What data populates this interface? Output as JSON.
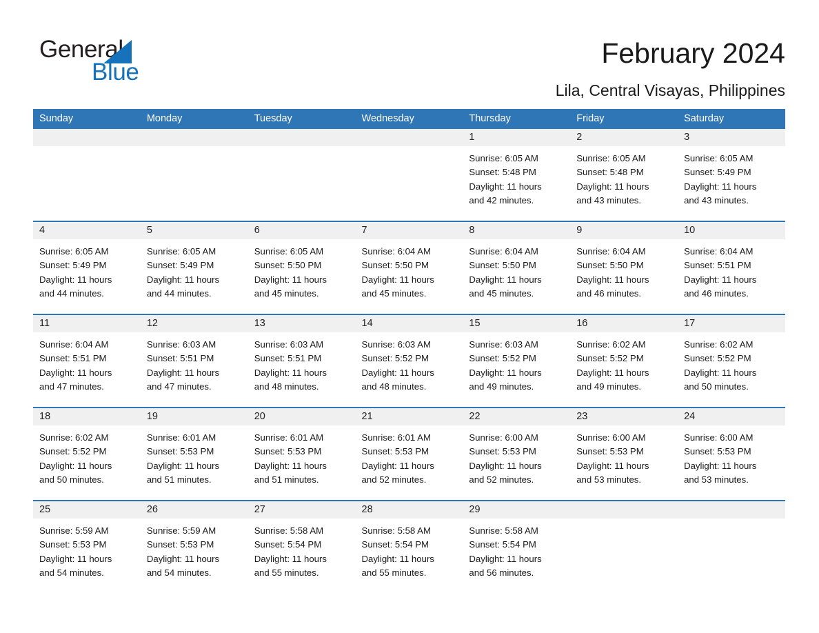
{
  "brand": {
    "name_part1": "General",
    "name_part2": "Blue",
    "logo_blue": "#1673bb"
  },
  "header": {
    "title": "February 2024",
    "subtitle": "Lila, Central Visayas, Philippines"
  },
  "theme": {
    "header_blue": "#2f76b7",
    "daynum_band": "#f0f0f0",
    "text": "#1a1a1a"
  },
  "weekdays": [
    "Sunday",
    "Monday",
    "Tuesday",
    "Wednesday",
    "Thursday",
    "Friday",
    "Saturday"
  ],
  "weeks": [
    [
      {
        "day": "",
        "empty": true
      },
      {
        "day": "",
        "empty": true
      },
      {
        "day": "",
        "empty": true
      },
      {
        "day": "",
        "empty": true
      },
      {
        "day": "1",
        "sunrise": "Sunrise: 6:05 AM",
        "sunset": "Sunset: 5:48 PM",
        "daylight_line1": "Daylight: 11 hours",
        "daylight_line2": "and 42 minutes."
      },
      {
        "day": "2",
        "sunrise": "Sunrise: 6:05 AM",
        "sunset": "Sunset: 5:48 PM",
        "daylight_line1": "Daylight: 11 hours",
        "daylight_line2": "and 43 minutes."
      },
      {
        "day": "3",
        "sunrise": "Sunrise: 6:05 AM",
        "sunset": "Sunset: 5:49 PM",
        "daylight_line1": "Daylight: 11 hours",
        "daylight_line2": "and 43 minutes."
      }
    ],
    [
      {
        "day": "4",
        "sunrise": "Sunrise: 6:05 AM",
        "sunset": "Sunset: 5:49 PM",
        "daylight_line1": "Daylight: 11 hours",
        "daylight_line2": "and 44 minutes."
      },
      {
        "day": "5",
        "sunrise": "Sunrise: 6:05 AM",
        "sunset": "Sunset: 5:49 PM",
        "daylight_line1": "Daylight: 11 hours",
        "daylight_line2": "and 44 minutes."
      },
      {
        "day": "6",
        "sunrise": "Sunrise: 6:05 AM",
        "sunset": "Sunset: 5:50 PM",
        "daylight_line1": "Daylight: 11 hours",
        "daylight_line2": "and 45 minutes."
      },
      {
        "day": "7",
        "sunrise": "Sunrise: 6:04 AM",
        "sunset": "Sunset: 5:50 PM",
        "daylight_line1": "Daylight: 11 hours",
        "daylight_line2": "and 45 minutes."
      },
      {
        "day": "8",
        "sunrise": "Sunrise: 6:04 AM",
        "sunset": "Sunset: 5:50 PM",
        "daylight_line1": "Daylight: 11 hours",
        "daylight_line2": "and 45 minutes."
      },
      {
        "day": "9",
        "sunrise": "Sunrise: 6:04 AM",
        "sunset": "Sunset: 5:50 PM",
        "daylight_line1": "Daylight: 11 hours",
        "daylight_line2": "and 46 minutes."
      },
      {
        "day": "10",
        "sunrise": "Sunrise: 6:04 AM",
        "sunset": "Sunset: 5:51 PM",
        "daylight_line1": "Daylight: 11 hours",
        "daylight_line2": "and 46 minutes."
      }
    ],
    [
      {
        "day": "11",
        "sunrise": "Sunrise: 6:04 AM",
        "sunset": "Sunset: 5:51 PM",
        "daylight_line1": "Daylight: 11 hours",
        "daylight_line2": "and 47 minutes."
      },
      {
        "day": "12",
        "sunrise": "Sunrise: 6:03 AM",
        "sunset": "Sunset: 5:51 PM",
        "daylight_line1": "Daylight: 11 hours",
        "daylight_line2": "and 47 minutes."
      },
      {
        "day": "13",
        "sunrise": "Sunrise: 6:03 AM",
        "sunset": "Sunset: 5:51 PM",
        "daylight_line1": "Daylight: 11 hours",
        "daylight_line2": "and 48 minutes."
      },
      {
        "day": "14",
        "sunrise": "Sunrise: 6:03 AM",
        "sunset": "Sunset: 5:52 PM",
        "daylight_line1": "Daylight: 11 hours",
        "daylight_line2": "and 48 minutes."
      },
      {
        "day": "15",
        "sunrise": "Sunrise: 6:03 AM",
        "sunset": "Sunset: 5:52 PM",
        "daylight_line1": "Daylight: 11 hours",
        "daylight_line2": "and 49 minutes."
      },
      {
        "day": "16",
        "sunrise": "Sunrise: 6:02 AM",
        "sunset": "Sunset: 5:52 PM",
        "daylight_line1": "Daylight: 11 hours",
        "daylight_line2": "and 49 minutes."
      },
      {
        "day": "17",
        "sunrise": "Sunrise: 6:02 AM",
        "sunset": "Sunset: 5:52 PM",
        "daylight_line1": "Daylight: 11 hours",
        "daylight_line2": "and 50 minutes."
      }
    ],
    [
      {
        "day": "18",
        "sunrise": "Sunrise: 6:02 AM",
        "sunset": "Sunset: 5:52 PM",
        "daylight_line1": "Daylight: 11 hours",
        "daylight_line2": "and 50 minutes."
      },
      {
        "day": "19",
        "sunrise": "Sunrise: 6:01 AM",
        "sunset": "Sunset: 5:53 PM",
        "daylight_line1": "Daylight: 11 hours",
        "daylight_line2": "and 51 minutes."
      },
      {
        "day": "20",
        "sunrise": "Sunrise: 6:01 AM",
        "sunset": "Sunset: 5:53 PM",
        "daylight_line1": "Daylight: 11 hours",
        "daylight_line2": "and 51 minutes."
      },
      {
        "day": "21",
        "sunrise": "Sunrise: 6:01 AM",
        "sunset": "Sunset: 5:53 PM",
        "daylight_line1": "Daylight: 11 hours",
        "daylight_line2": "and 52 minutes."
      },
      {
        "day": "22",
        "sunrise": "Sunrise: 6:00 AM",
        "sunset": "Sunset: 5:53 PM",
        "daylight_line1": "Daylight: 11 hours",
        "daylight_line2": "and 52 minutes."
      },
      {
        "day": "23",
        "sunrise": "Sunrise: 6:00 AM",
        "sunset": "Sunset: 5:53 PM",
        "daylight_line1": "Daylight: 11 hours",
        "daylight_line2": "and 53 minutes."
      },
      {
        "day": "24",
        "sunrise": "Sunrise: 6:00 AM",
        "sunset": "Sunset: 5:53 PM",
        "daylight_line1": "Daylight: 11 hours",
        "daylight_line2": "and 53 minutes."
      }
    ],
    [
      {
        "day": "25",
        "sunrise": "Sunrise: 5:59 AM",
        "sunset": "Sunset: 5:53 PM",
        "daylight_line1": "Daylight: 11 hours",
        "daylight_line2": "and 54 minutes."
      },
      {
        "day": "26",
        "sunrise": "Sunrise: 5:59 AM",
        "sunset": "Sunset: 5:53 PM",
        "daylight_line1": "Daylight: 11 hours",
        "daylight_line2": "and 54 minutes."
      },
      {
        "day": "27",
        "sunrise": "Sunrise: 5:58 AM",
        "sunset": "Sunset: 5:54 PM",
        "daylight_line1": "Daylight: 11 hours",
        "daylight_line2": "and 55 minutes."
      },
      {
        "day": "28",
        "sunrise": "Sunrise: 5:58 AM",
        "sunset": "Sunset: 5:54 PM",
        "daylight_line1": "Daylight: 11 hours",
        "daylight_line2": "and 55 minutes."
      },
      {
        "day": "29",
        "sunrise": "Sunrise: 5:58 AM",
        "sunset": "Sunset: 5:54 PM",
        "daylight_line1": "Daylight: 11 hours",
        "daylight_line2": "and 56 minutes."
      },
      {
        "day": "",
        "empty": true
      },
      {
        "day": "",
        "empty": true
      }
    ]
  ]
}
